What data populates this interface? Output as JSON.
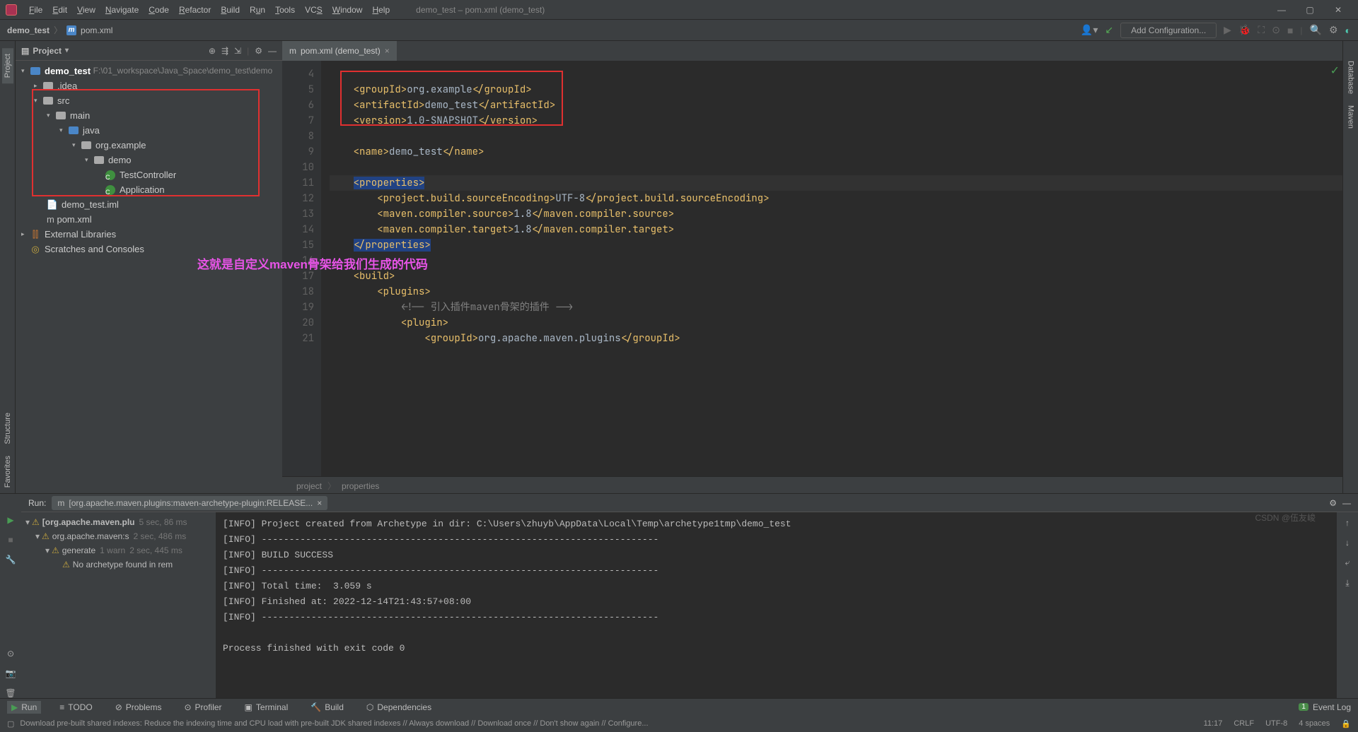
{
  "window_title": "demo_test – pom.xml (demo_test)",
  "menu": [
    "File",
    "Edit",
    "View",
    "Navigate",
    "Code",
    "Refactor",
    "Build",
    "Run",
    "Tools",
    "VCS",
    "Window",
    "Help"
  ],
  "breadcrumb": {
    "root": "demo_test",
    "file": "pom.xml",
    "m": "m"
  },
  "toolbar": {
    "add_config": "Add Configuration..."
  },
  "project_panel": {
    "title": "Project",
    "tree": {
      "root": {
        "name": "demo_test",
        "path": "F:\\01_workspace\\Java_Space\\demo_test\\demo"
      },
      "idea": ".idea",
      "src": "src",
      "main": "main",
      "java": "java",
      "pkg": "org.example",
      "demo": "demo",
      "tc": "TestController",
      "app": "Application",
      "iml": "demo_test.iml",
      "pom": "pom.xml",
      "ext": "External Libraries",
      "scratch": "Scratches and Consoles"
    }
  },
  "editor": {
    "tab": "pom.xml (demo_test)",
    "line_start": 4,
    "lines": {
      "l5": {
        "t1": "<groupId>",
        "v": "org.example",
        "t2": "</groupId>"
      },
      "l6": {
        "t1": "<artifactId>",
        "v": "demo_test",
        "t2": "</artifactId>"
      },
      "l7": {
        "t1": "<version>",
        "v": "1.0-SNAPSHOT",
        "t2": "</version>"
      },
      "l9": {
        "t1": "<name>",
        "v": "demo_test",
        "t2": "</name>"
      },
      "l11": {
        "t": "<properties>"
      },
      "l12": {
        "t1": "<project.build.sourceEncoding>",
        "v": "UTF-8",
        "t2": "</project.build.sourceEncoding>"
      },
      "l13": {
        "t1": "<maven.compiler.source>",
        "v": "1.8",
        "t2": "</maven.compiler.source>"
      },
      "l14": {
        "t1": "<maven.compiler.target>",
        "v": "1.8",
        "t2": "</maven.compiler.target>"
      },
      "l15": {
        "t": "</properties>"
      },
      "l17": {
        "t": "<build>"
      },
      "l18": {
        "t": "<plugins>"
      },
      "l19": {
        "c": "<!-- 引入插件maven骨架的插件 -->"
      },
      "l20": {
        "t": "<plugin>"
      },
      "l21": {
        "t1": "<groupId>",
        "v": "org.apache.maven.plugins",
        "t2": "</groupId>"
      }
    },
    "crumb": [
      "project",
      "properties"
    ],
    "annotation": "这就是自定义maven骨架给我们生成的代码"
  },
  "run": {
    "label": "Run:",
    "tab": "[org.apache.maven.plugins:maven-archetype-plugin:RELEASE...",
    "tree": {
      "r1": {
        "t": "[org.apache.maven.plu",
        "m": "5 sec, 86 ms"
      },
      "r2": {
        "t": "org.apache.maven:s",
        "m": "2 sec, 486 ms"
      },
      "r3": {
        "t": "generate",
        "w": "1 warn",
        "m": "2 sec, 445 ms"
      },
      "r4": {
        "t": "No archetype found in rem"
      }
    },
    "console": [
      "[INFO] Project created from Archetype in dir: C:\\Users\\zhuyb\\AppData\\Local\\Temp\\archetype1tmp\\demo_test",
      "[INFO] ------------------------------------------------------------------------",
      "[INFO] BUILD SUCCESS",
      "[INFO] ------------------------------------------------------------------------",
      "[INFO] Total time:  3.059 s",
      "[INFO] Finished at: 2022-12-14T21:43:57+08:00",
      "[INFO] ------------------------------------------------------------------------",
      "",
      "Process finished with exit code 0"
    ]
  },
  "bottom": {
    "run": "Run",
    "todo": "TODO",
    "problems": "Problems",
    "profiler": "Profiler",
    "terminal": "Terminal",
    "build": "Build",
    "deps": "Dependencies",
    "eventlog": "Event Log"
  },
  "status": {
    "msg": "Download pre-built shared indexes: Reduce the indexing time and CPU load with pre-built JDK shared indexes // Always download // Download once // Don't show again // Configure...",
    "pos": "11:17",
    "crlf": "CRLF",
    "enc": "UTF-8",
    "indent": "4 spaces"
  },
  "sidebars": {
    "project": "Project",
    "structure": "Structure",
    "favorites": "Favorites",
    "database": "Database",
    "maven": "Maven"
  },
  "watermark": "CSDN @伍友峻"
}
